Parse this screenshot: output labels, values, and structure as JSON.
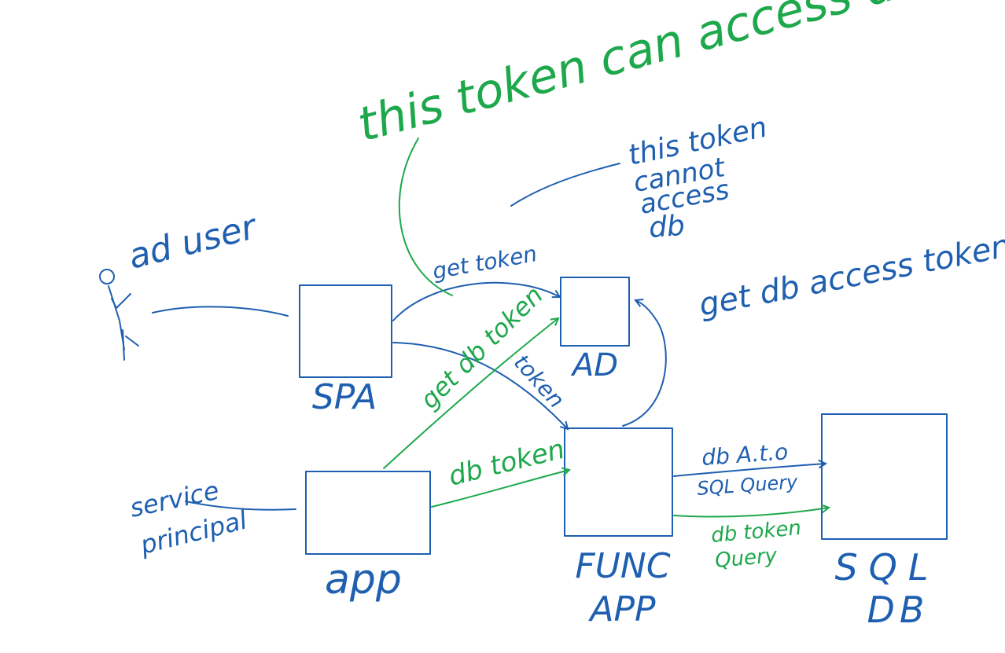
{
  "colors": {
    "blue": "#1f5fb0",
    "green": "#1ea84c",
    "background": "#ffffff"
  },
  "nodes": {
    "spa": "SPA",
    "ad": "AD",
    "app": "app",
    "func_app": {
      "line1": "FUNC",
      "line2": "APP"
    },
    "sql_db": {
      "line1": "SQL",
      "line2": "DB"
    },
    "ad_user": "ad user",
    "service_principal": {
      "line1": "service",
      "line2": "principal"
    }
  },
  "annotations": {
    "this_token_can_access_db": "this token can access db",
    "this_token_cannot_access_db": [
      "this token",
      "cannot",
      "access",
      "db"
    ],
    "get_db_access_token": "get db access token"
  },
  "edges": {
    "spa_get_token": "get token",
    "spa_token": "token",
    "app_get_db_token": "get db token",
    "app_db_token": "db token",
    "func_to_sql_1": [
      "db A.t.o",
      "SQL Query"
    ],
    "func_to_sql_2": [
      "db token",
      "Query"
    ]
  }
}
